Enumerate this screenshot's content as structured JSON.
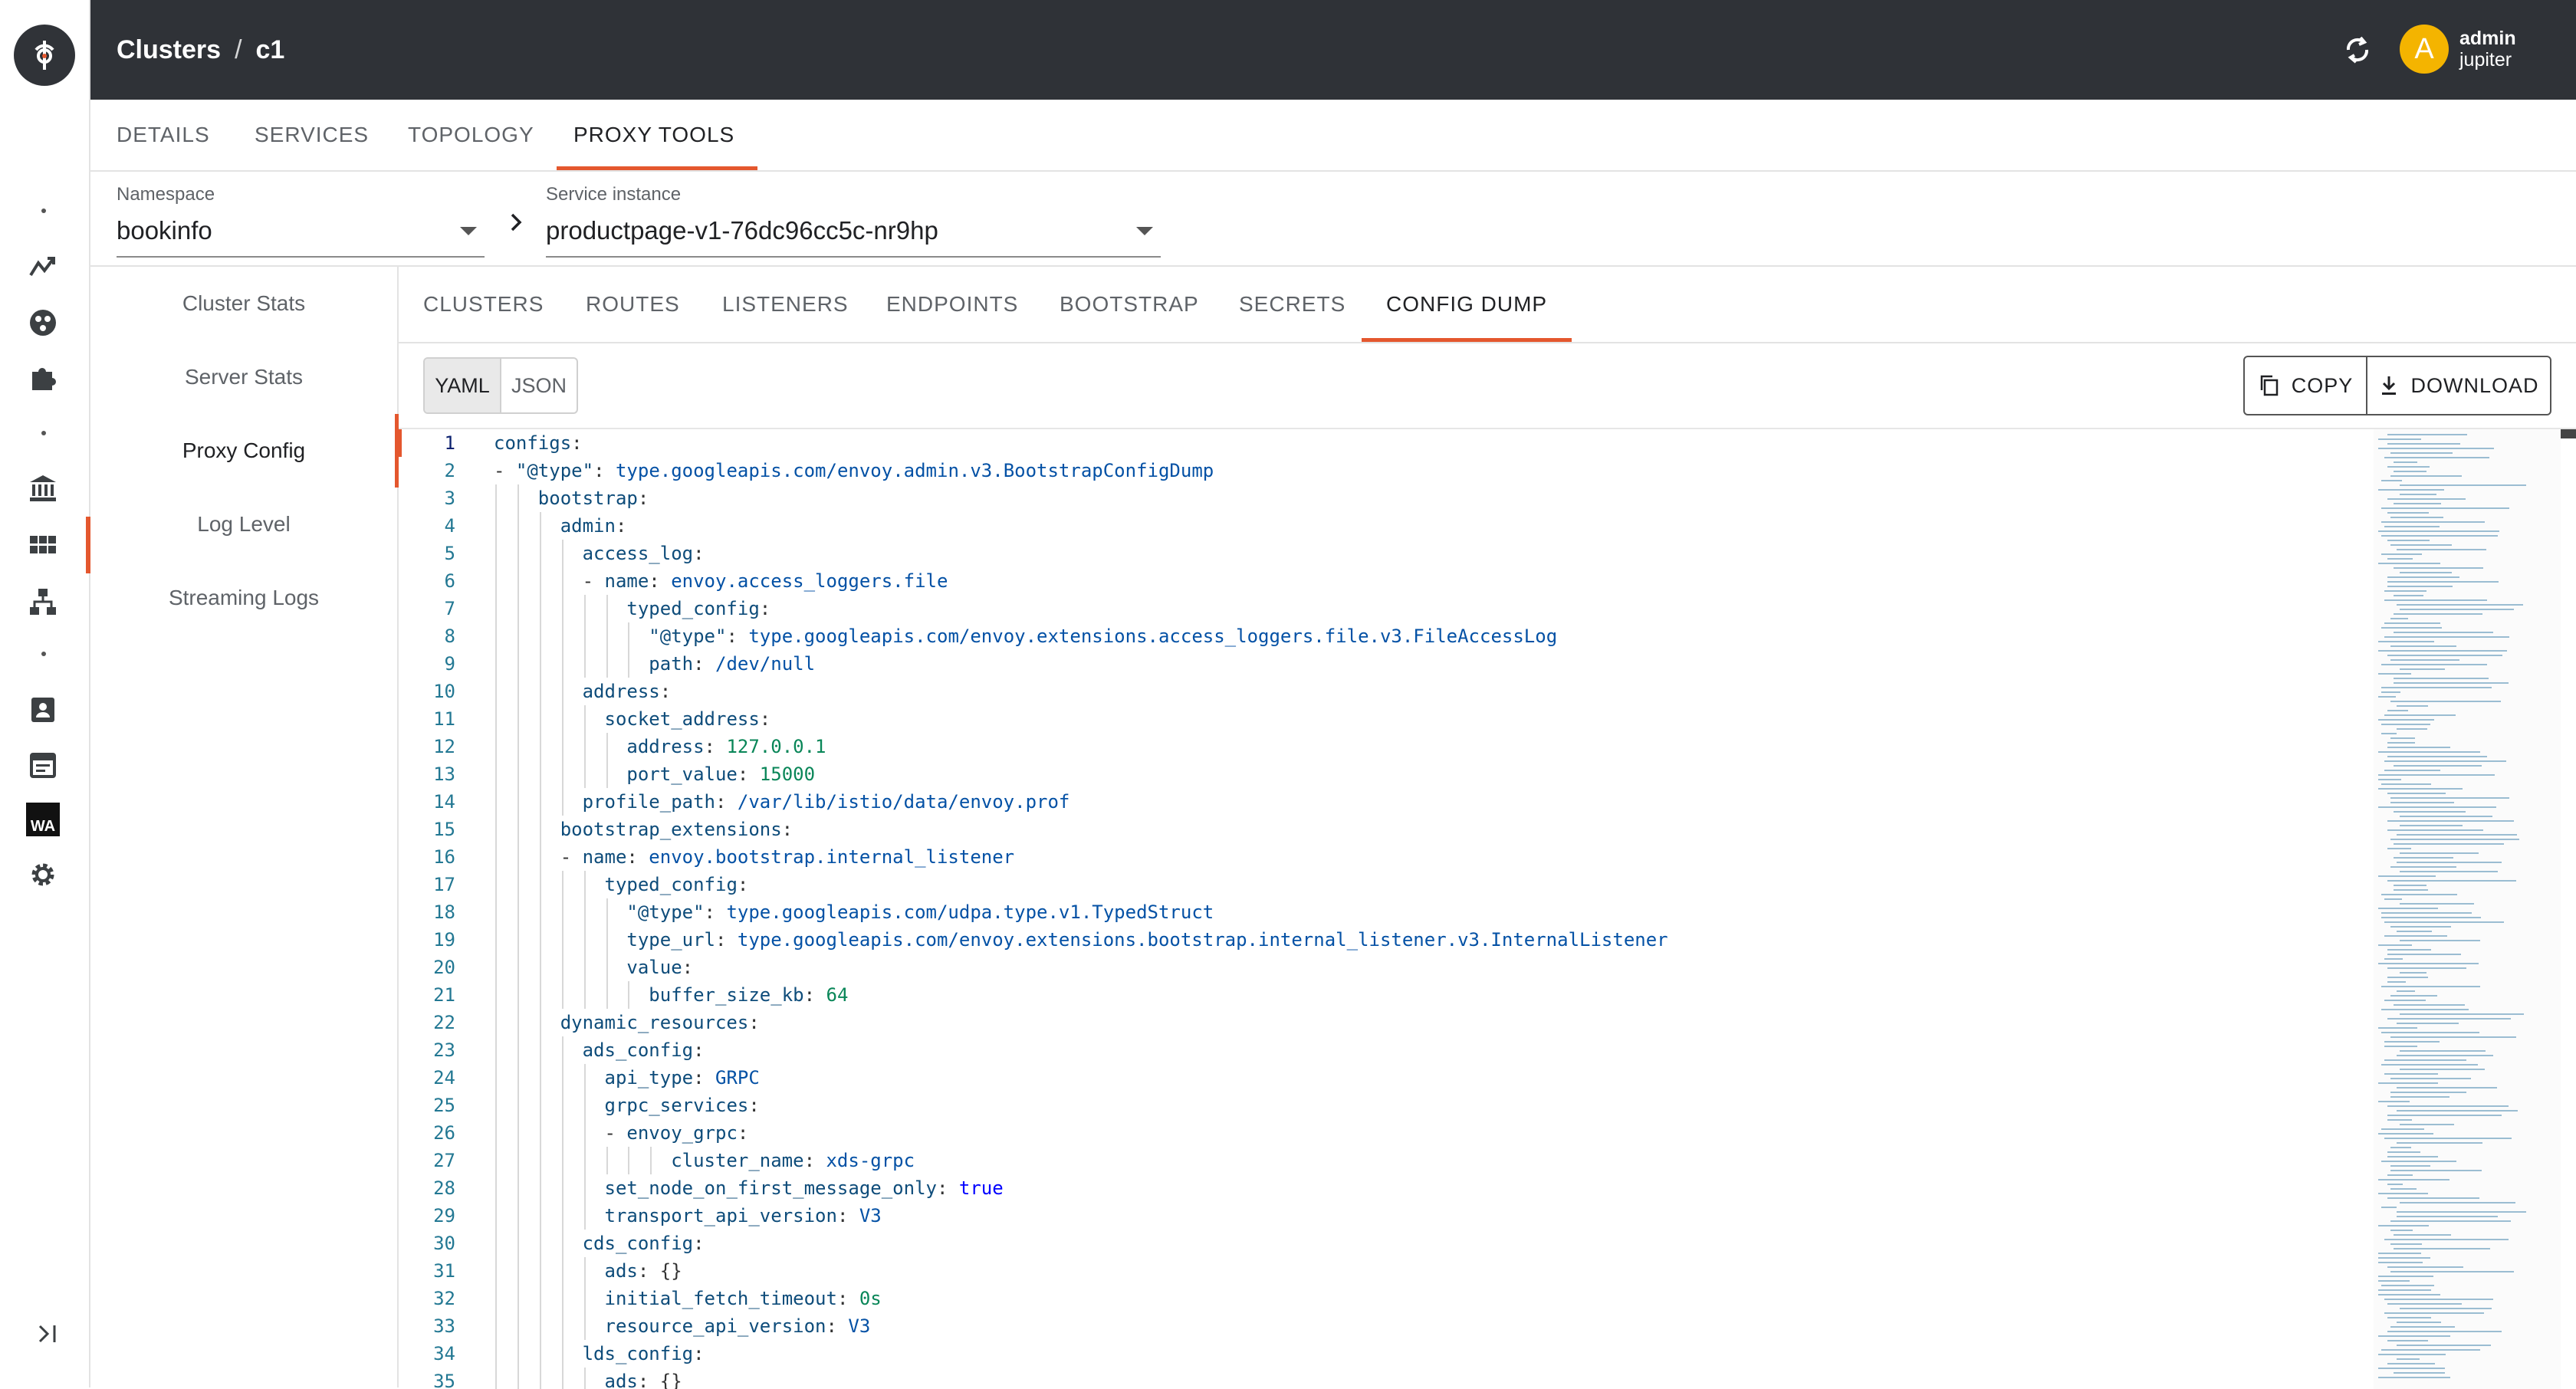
{
  "header": {
    "breadcrumb_root": "Clusters",
    "breadcrumb_sep": "/",
    "breadcrumb_current": "c1",
    "user_initial": "A",
    "user_name": "admin",
    "user_org": "jupiter"
  },
  "rail": {
    "wa_label": "WA"
  },
  "top_tabs": [
    "DETAILS",
    "SERVICES",
    "TOPOLOGY",
    "PROXY TOOLS"
  ],
  "selectors": {
    "namespace_label": "Namespace",
    "namespace_value": "bookinfo",
    "instance_label": "Service instance",
    "instance_value": "productpage-v1-76dc96cc5c-nr9hp"
  },
  "side_menu": [
    "Cluster Stats",
    "Server Stats",
    "Proxy Config",
    "Log Level",
    "Streaming Logs"
  ],
  "sub_tabs": [
    "CLUSTERS",
    "ROUTES",
    "LISTENERS",
    "ENDPOINTS",
    "BOOTSTRAP",
    "SECRETS",
    "CONFIG DUMP"
  ],
  "toolbar": {
    "yaml_label": "YAML",
    "json_label": "JSON",
    "copy_label": "COPY",
    "download_label": "DOWNLOAD"
  },
  "code_lines": [
    {
      "n": "1",
      "i": 0,
      "k": "configs",
      "v": ""
    },
    {
      "n": "2",
      "i": 1,
      "d": true,
      "k": "\"@type\"",
      "v": "type.googleapis.com/envoy.admin.v3.BootstrapConfigDump",
      "t": "s"
    },
    {
      "n": "3",
      "i": 2,
      "k": "bootstrap",
      "v": ""
    },
    {
      "n": "4",
      "i": 3,
      "k": "admin",
      "v": ""
    },
    {
      "n": "5",
      "i": 4,
      "k": "access_log",
      "v": ""
    },
    {
      "n": "6",
      "i": 5,
      "d": true,
      "k": "name",
      "v": "envoy.access_loggers.file",
      "t": "s"
    },
    {
      "n": "7",
      "i": 6,
      "k": "typed_config",
      "v": ""
    },
    {
      "n": "8",
      "i": 7,
      "k": "\"@type\"",
      "v": "type.googleapis.com/envoy.extensions.access_loggers.file.v3.FileAccessLog",
      "t": "s"
    },
    {
      "n": "9",
      "i": 7,
      "k": "path",
      "v": "/dev/null",
      "t": "s"
    },
    {
      "n": "10",
      "i": 4,
      "k": "address",
      "v": ""
    },
    {
      "n": "11",
      "i": 5,
      "k": "socket_address",
      "v": ""
    },
    {
      "n": "12",
      "i": 6,
      "k": "address",
      "v": "127.0.0.1",
      "t": "n"
    },
    {
      "n": "13",
      "i": 6,
      "k": "port_value",
      "v": "15000",
      "t": "n"
    },
    {
      "n": "14",
      "i": 4,
      "k": "profile_path",
      "v": "/var/lib/istio/data/envoy.prof",
      "t": "s"
    },
    {
      "n": "15",
      "i": 3,
      "k": "bootstrap_extensions",
      "v": ""
    },
    {
      "n": "16",
      "i": 4,
      "d": true,
      "k": "name",
      "v": "envoy.bootstrap.internal_listener",
      "t": "s"
    },
    {
      "n": "17",
      "i": 5,
      "k": "typed_config",
      "v": ""
    },
    {
      "n": "18",
      "i": 6,
      "k": "\"@type\"",
      "v": "type.googleapis.com/udpa.type.v1.TypedStruct",
      "t": "s"
    },
    {
      "n": "19",
      "i": 6,
      "k": "type_url",
      "v": "type.googleapis.com/envoy.extensions.bootstrap.internal_listener.v3.InternalListener",
      "t": "s"
    },
    {
      "n": "20",
      "i": 6,
      "k": "value",
      "v": ""
    },
    {
      "n": "21",
      "i": 7,
      "k": "buffer_size_kb",
      "v": "64",
      "t": "n"
    },
    {
      "n": "22",
      "i": 3,
      "k": "dynamic_resources",
      "v": ""
    },
    {
      "n": "23",
      "i": 4,
      "k": "ads_config",
      "v": ""
    },
    {
      "n": "24",
      "i": 5,
      "k": "api_type",
      "v": "GRPC",
      "t": "s"
    },
    {
      "n": "25",
      "i": 5,
      "k": "grpc_services",
      "v": ""
    },
    {
      "n": "26",
      "i": 6,
      "d": true,
      "k": "envoy_grpc",
      "v": ""
    },
    {
      "n": "27",
      "i": 8,
      "k": "cluster_name",
      "v": "xds-grpc",
      "t": "s"
    },
    {
      "n": "28",
      "i": 5,
      "k": "set_node_on_first_message_only",
      "v": "true",
      "t": "b"
    },
    {
      "n": "29",
      "i": 5,
      "k": "transport_api_version",
      "v": "V3",
      "t": "s"
    },
    {
      "n": "30",
      "i": 4,
      "k": "cds_config",
      "v": ""
    },
    {
      "n": "31",
      "i": 5,
      "k": "ads",
      "v": "{}",
      "t": "p"
    },
    {
      "n": "32",
      "i": 5,
      "k": "initial_fetch_timeout",
      "v": "0s",
      "t": "n"
    },
    {
      "n": "33",
      "i": 5,
      "k": "resource_api_version",
      "v": "V3",
      "t": "s"
    },
    {
      "n": "34",
      "i": 4,
      "k": "lds_config",
      "v": ""
    },
    {
      "n": "35",
      "i": 5,
      "k": "ads",
      "v": "{}",
      "t": "p"
    }
  ]
}
